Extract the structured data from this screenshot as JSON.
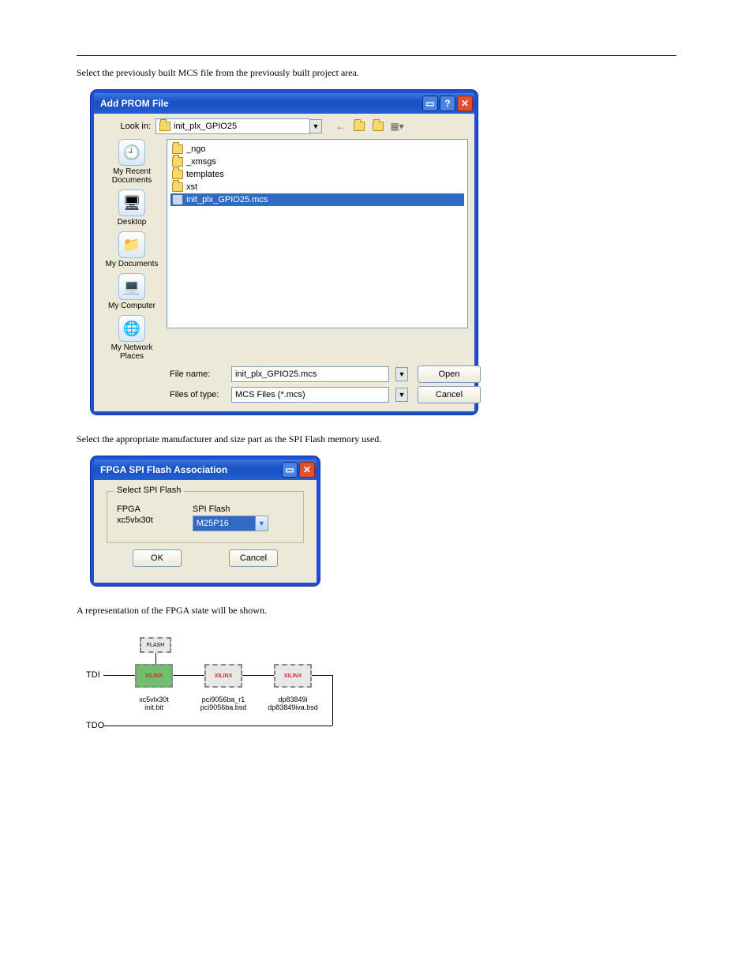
{
  "paragraphs": {
    "p1": "Select the previously built MCS file from the previously built project area.",
    "p2": "Select the appropriate manufacturer and size part as the SPI Flash memory used.",
    "p3": "A representation of the FPGA state will be shown."
  },
  "addPromDialog": {
    "title": "Add PROM File",
    "lookInLabel": "Look in:",
    "lookInValue": "init_plx_GPIO25",
    "toolbarIcons": {
      "back": "back-arrow-icon",
      "up": "folder-up-icon",
      "newFolder": "new-folder-icon",
      "viewMenu": "view-menu-icon"
    },
    "sidebar": [
      {
        "label": "My Recent Documents",
        "glyph": "🕘"
      },
      {
        "label": "Desktop",
        "glyph": "🖥"
      },
      {
        "label": "My Documents",
        "glyph": "📁"
      },
      {
        "label": "My Computer",
        "glyph": "💻"
      },
      {
        "label": "My Network Places",
        "glyph": "🌐"
      }
    ],
    "files": [
      {
        "name": "_ngo",
        "type": "folder"
      },
      {
        "name": "_xmsgs",
        "type": "folder"
      },
      {
        "name": "templates",
        "type": "folder"
      },
      {
        "name": "xst",
        "type": "folder"
      },
      {
        "name": "init_plx_GPIO25.mcs",
        "type": "mcs",
        "selected": true
      }
    ],
    "fileNameLabel": "File name:",
    "fileNameValue": "init_plx_GPIO25.mcs",
    "filesOfTypeLabel": "Files of type:",
    "filesOfTypeValue": "MCS Files (*.mcs)",
    "openBtn": "Open",
    "cancelBtn": "Cancel"
  },
  "spiDialog": {
    "title": "FPGA SPI Flash Association",
    "groupLabel": "Select SPI Flash",
    "fpgaHeader": "FPGA",
    "spiHeader": "SPI Flash",
    "fpgaValue": "xc5vlx30t",
    "spiValue": "M25P16",
    "okBtn": "OK",
    "cancelBtn": "Cancel"
  },
  "chain": {
    "tdi": "TDI",
    "tdo": "TDO",
    "flashLabel": "FLASH",
    "brand": "XILINX",
    "chip1": {
      "name": "xc5vlx30t",
      "file": "init.bit"
    },
    "chip2": {
      "name": "pci9056ba_r1",
      "file": "pci9056ba.bsd"
    },
    "chip3": {
      "name": "dp83849i",
      "file": "dp83849iva.bsd"
    }
  }
}
